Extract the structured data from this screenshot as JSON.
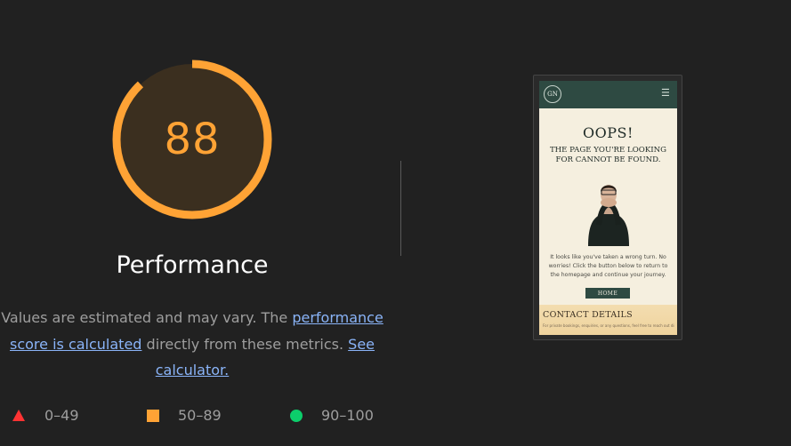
{
  "score": {
    "value": "88",
    "fraction": 0.88,
    "color": "#ffa335"
  },
  "category": {
    "title": "Performance"
  },
  "description": {
    "text1": "Values are estimated and may vary. The ",
    "link1": "performance score is calculated",
    "text2": " directly from these metrics. ",
    "link2": "See calculator."
  },
  "legend": [
    {
      "icon": "triangle-icon",
      "label": "0–49",
      "color": "#ff3333"
    },
    {
      "icon": "square-icon",
      "label": "50–89",
      "color": "#ffa335"
    },
    {
      "icon": "circle-icon",
      "label": "90–100",
      "color": "#0cce6b"
    }
  ],
  "screenshot": {
    "logo": "GN",
    "menu_icon": "hamburger-icon",
    "title": "OOPS!",
    "subtitle": "THE PAGE YOU'RE LOOKING FOR CANNOT BE FOUND.",
    "body": "It looks like you've taken a wrong turn. No worries! Click the button below to return to the homepage and continue your journey.",
    "button": "HOME",
    "contact_title": "CONTACT DETAILS",
    "contact_text": "For private bookings, enquiries, or any questions, feel free to reach out directly. Don't forget to follow Danny Nevar on social media for the"
  }
}
